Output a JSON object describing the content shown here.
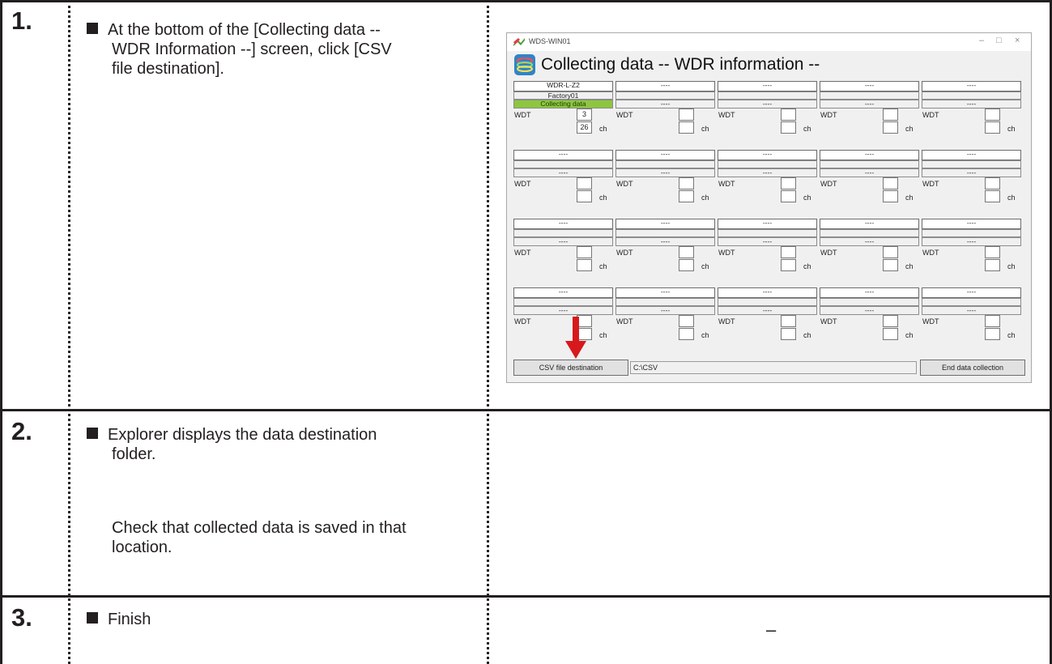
{
  "steps": [
    {
      "number": "1.",
      "lines": [
        "At the bottom of the [Collecting data --",
        "WDR Information --] screen, click [CSV",
        "file destination]."
      ]
    },
    {
      "number": "2.",
      "lines": [
        "Explorer displays the data destination",
        "folder."
      ],
      "note_lines": [
        "Check that collected data is saved in that",
        "location."
      ]
    },
    {
      "number": "3.",
      "lines": [
        "Finish"
      ],
      "right_text": "–"
    }
  ],
  "app": {
    "window_title": "WDS-WIN01",
    "window_controls": {
      "minimize": "–",
      "maximize": "□",
      "close": "×"
    },
    "heading": "Collecting data -- WDR information --",
    "wdt_label": "WDT",
    "ch_label": "ch",
    "rows": [
      [
        {
          "name": "WDR-L-Z2",
          "location": "Factory01",
          "status": "Collecting data",
          "wdt": "3",
          "ch": "26"
        },
        {
          "name": "----",
          "location": "",
          "status": "----",
          "wdt": "",
          "ch": ""
        },
        {
          "name": "----",
          "location": "",
          "status": "----",
          "wdt": "",
          "ch": ""
        },
        {
          "name": "----",
          "location": "",
          "status": "----",
          "wdt": "",
          "ch": ""
        },
        {
          "name": "----",
          "location": "",
          "status": "----",
          "wdt": "",
          "ch": ""
        }
      ],
      [
        {
          "name": "----",
          "location": "",
          "status": "----",
          "wdt": "",
          "ch": ""
        },
        {
          "name": "----",
          "location": "",
          "status": "----",
          "wdt": "",
          "ch": ""
        },
        {
          "name": "----",
          "location": "",
          "status": "----",
          "wdt": "",
          "ch": ""
        },
        {
          "name": "----",
          "location": "",
          "status": "----",
          "wdt": "",
          "ch": ""
        },
        {
          "name": "----",
          "location": "",
          "status": "----",
          "wdt": "",
          "ch": ""
        }
      ],
      [
        {
          "name": "----",
          "location": "",
          "status": "----",
          "wdt": "",
          "ch": ""
        },
        {
          "name": "----",
          "location": "",
          "status": "----",
          "wdt": "",
          "ch": ""
        },
        {
          "name": "----",
          "location": "",
          "status": "----",
          "wdt": "",
          "ch": ""
        },
        {
          "name": "----",
          "location": "",
          "status": "----",
          "wdt": "",
          "ch": ""
        },
        {
          "name": "----",
          "location": "",
          "status": "----",
          "wdt": "",
          "ch": ""
        }
      ],
      [
        {
          "name": "----",
          "location": "",
          "status": "----",
          "wdt": "",
          "ch": ""
        },
        {
          "name": "----",
          "location": "",
          "status": "----",
          "wdt": "",
          "ch": ""
        },
        {
          "name": "----",
          "location": "",
          "status": "----",
          "wdt": "",
          "ch": ""
        },
        {
          "name": "----",
          "location": "",
          "status": "----",
          "wdt": "",
          "ch": ""
        },
        {
          "name": "----",
          "location": "",
          "status": "----",
          "wdt": "",
          "ch": ""
        }
      ]
    ],
    "csv_button": "CSV file destination",
    "csv_path": "C:\\CSV",
    "end_button": "End data collection"
  },
  "colors": {
    "rule": "#231f20",
    "collecting_status": "#8dc63f",
    "arrow": "#d7191c"
  },
  "icons": [
    "bullet-square-icon",
    "app-logo-icon",
    "red-down-arrow-icon"
  ]
}
